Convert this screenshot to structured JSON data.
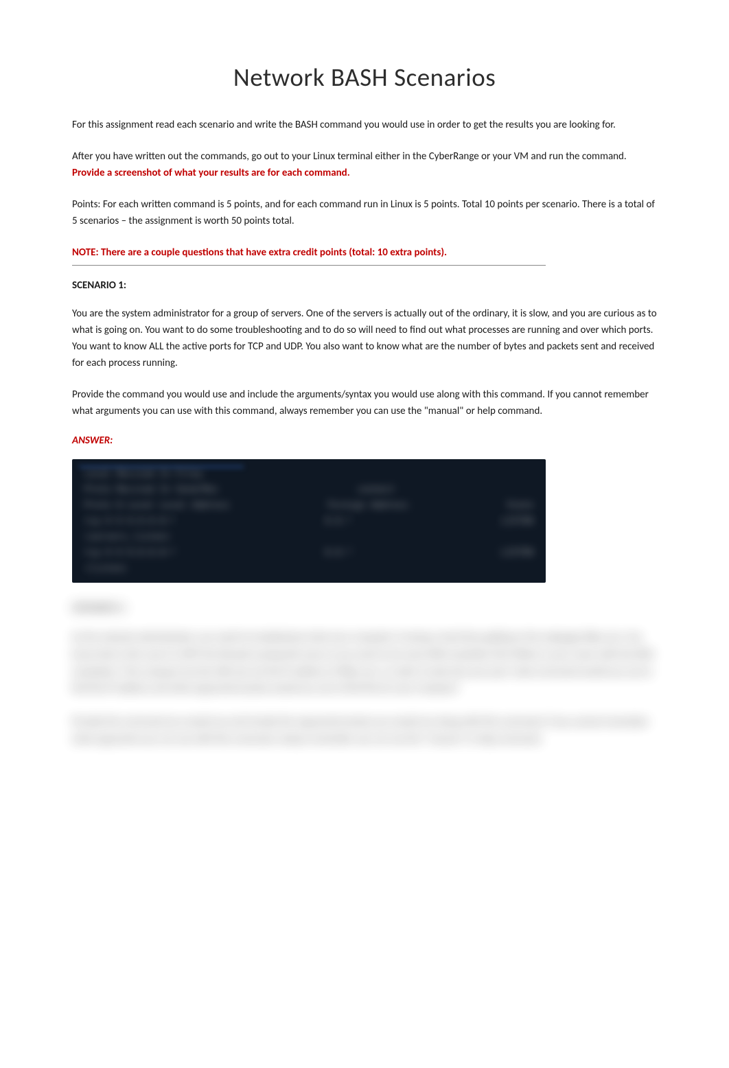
{
  "title": "Network BASH Scenarios",
  "intro": {
    "p1": "For this assignment read each scenario and write the BASH command you would use in order to get the results you are looking for.",
    "p2_prefix": "After you have written out the commands, go out to your Linux terminal either in the CyberRange or your VM and run the command.  ",
    "p2_emphasis": "Provide a screenshot of what your results are for each command.",
    "p3": "Points:  For each written command is 5 points, and for each command run in Linux is 5 points.  Total 10 points per scenario.  There is a total of 5 scenarios – the assignment is worth 50 points total."
  },
  "note": "NOTE: There are a couple questions that have extra credit points (total: 10 extra points).",
  "scenario1": {
    "heading": "SCENARIO 1:",
    "body1": "You are the system administrator for a group of servers.  One of the servers is actually out of the ordinary, it is slow, and you are curious as to what is going on.  You want to do some troubleshooting and to do so will need to find out what processes are running and over which ports. You want to know ALL the active ports for TCP and UDP. You also want to know what are the number of bytes and packets sent and received for each process running.",
    "body2": "Provide the command you would use and include the arguments/syntax you would use along with this command.  If you cannot remember what arguments you can use with this command, always remember you can use the \"manual\" or help command."
  },
  "answer_label": "ANSWER:",
  "terminal": {
    "rows": [
      {
        "left": "Local   Recvied   In   Filey",
        "mid": "",
        "right": ""
      },
      {
        "left": "Proto   Recvied   In   Send/Rec",
        "mid": "connect",
        "right": ""
      },
      {
        "left": "Proto   Q     Local Local   Address",
        "mid": "Foreign  Address",
        "right": "State"
      },
      {
        "left": "tcp        0      0  0.0.0.0:*",
        "mid": "0.0.*",
        "right": "LISTEN"
      },
      {
        "left": "    (servers_listen)",
        "mid": "",
        "right": ""
      },
      {
        "left": "tcp        0      0  0.0.0.0:*",
        "mid": "0.0.*",
        "right": "LISTEN"
      },
      {
        "left": "    (listen)",
        "mid": "",
        "right": ""
      }
    ]
  },
  "scenario2_blurred": {
    "heading": "SCENARIO 2:",
    "body1": "As the network administrator, you need to troubleshoot what your computer is having a hard time getting to the webpage Nike.com.   You know that in this case it is NOT the firewall causing this issue so you want to do some DNS resolution first (When is your name with the DNS resolution).   This company has the URL but not the IP address of Nike.com.   In order to look into your part, what command would you use to find the IP address and what arguments/syntax  would you use to find this for your company?",
    "body2": "Provide the command you would use and include the arguments/syntax you would use along with this command.  If you cannot remember what arguments you can use with this command, always remember you can use the \"manual\" or help command."
  }
}
